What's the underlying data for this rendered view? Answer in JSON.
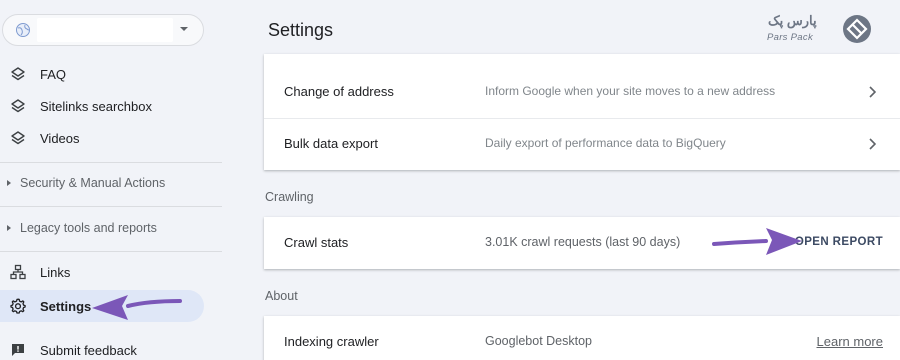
{
  "header": {
    "title": "Settings"
  },
  "logo": {
    "text_fa": "پارس پک",
    "text_en": "Pars Pack",
    "color": "#6d7685"
  },
  "sidebar": {
    "property_icon": "globe-icon",
    "dropdown_icon": "caret-down-icon",
    "items": [
      {
        "label": "FAQ",
        "icon": "layers-icon"
      },
      {
        "label": "Sitelinks searchbox",
        "icon": "layers-icon"
      },
      {
        "label": "Videos",
        "icon": "layers-icon"
      }
    ],
    "sections": [
      {
        "label": "Security & Manual Actions"
      },
      {
        "label": "Legacy tools and reports"
      }
    ],
    "bottom_items": [
      {
        "label": "Links",
        "icon": "sitemap-icon"
      },
      {
        "label": "Settings",
        "icon": "gear-icon",
        "active": true
      },
      {
        "label": "Submit feedback",
        "icon": "feedback-icon"
      }
    ]
  },
  "general": {
    "rows": [
      {
        "title": "Change of address",
        "description": "Inform Google when your site moves to a new address"
      },
      {
        "title": "Bulk data export",
        "description": "Daily export of performance data to BigQuery"
      }
    ]
  },
  "crawling": {
    "heading": "Crawling",
    "row": {
      "title": "Crawl stats",
      "value": "3.01K crawl requests (last 90 days)",
      "action": "OPEN REPORT"
    }
  },
  "about": {
    "heading": "About",
    "row": {
      "title": "Indexing crawler",
      "value": "Googlebot Desktop",
      "action": "Learn more"
    }
  },
  "colors": {
    "annotation_arrow": "#7b57b8",
    "active_nav_bg": "#dfe7f7",
    "page_bg": "#f1f3f8"
  }
}
